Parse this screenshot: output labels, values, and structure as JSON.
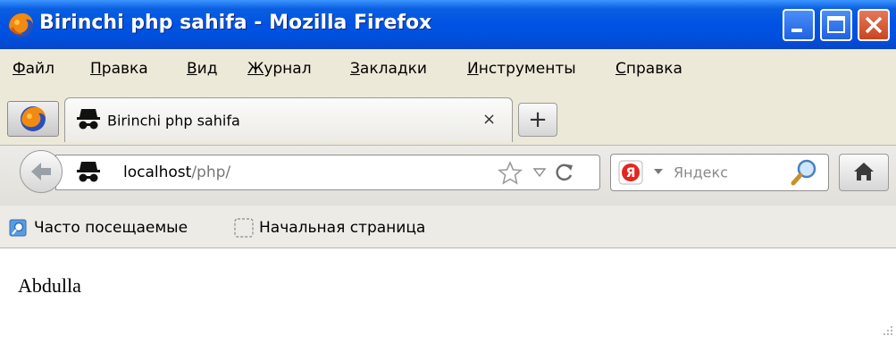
{
  "window": {
    "title": "Birinchi php sahifa - Mozilla Firefox"
  },
  "menu": {
    "items": [
      {
        "accel": "Ф",
        "rest": "айл"
      },
      {
        "accel": "П",
        "rest": "равка"
      },
      {
        "accel": "В",
        "rest": "ид"
      },
      {
        "accel": "Ж",
        "rest": "урнал"
      },
      {
        "accel": "З",
        "rest": "акладки"
      },
      {
        "accel": "И",
        "rest": "нструменты"
      },
      {
        "accel": "С",
        "rest": "правка"
      }
    ]
  },
  "tab": {
    "title": "Birinchi php sahifa",
    "close_glyph": "×",
    "new_tab_glyph": "+"
  },
  "address": {
    "host": "localhost",
    "path": "/php/"
  },
  "search": {
    "placeholder": "Яндекс"
  },
  "bookmarks": {
    "most_visited": "Часто посещаемые",
    "home_page": "Начальная страница"
  },
  "page": {
    "text": "Abdulla"
  },
  "colors": {
    "titlebar": "#0054e3",
    "close_button": "#c84620",
    "chrome": "#ece9d8"
  }
}
